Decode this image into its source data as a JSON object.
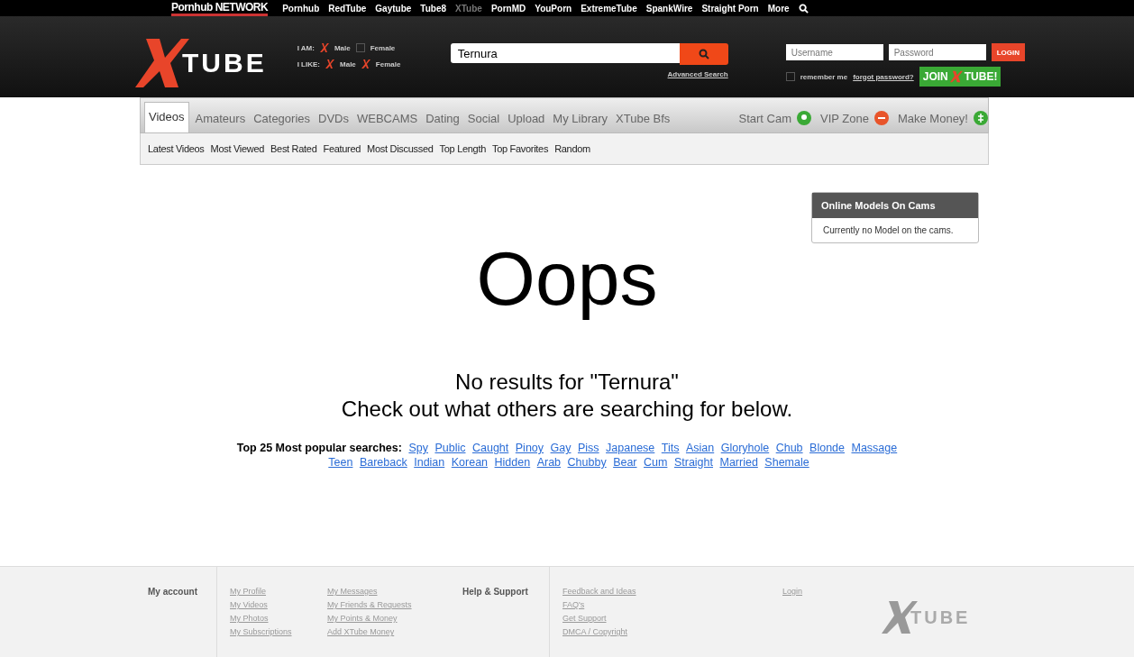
{
  "network": {
    "brand": "Pornhub NETWORK",
    "sites": [
      {
        "label": "Pornhub",
        "selected": false
      },
      {
        "label": "RedTube",
        "selected": false
      },
      {
        "label": "Gaytube",
        "selected": false
      },
      {
        "label": "Tube8",
        "selected": false
      },
      {
        "label": "XTube",
        "selected": true
      },
      {
        "label": "PornMD",
        "selected": false
      },
      {
        "label": "YouPorn",
        "selected": false
      },
      {
        "label": "ExtremeTube",
        "selected": false
      },
      {
        "label": "SpankWire",
        "selected": false
      },
      {
        "label": "Straight Porn",
        "selected": false
      },
      {
        "label": "More",
        "selected": false
      }
    ]
  },
  "header": {
    "logo": "TUBE",
    "preferences": [
      {
        "label": "I AM:",
        "options": [
          {
            "label": "Male",
            "checked": true
          },
          {
            "label": "Female",
            "checked": false
          }
        ]
      },
      {
        "label": "I LIKE:",
        "options": [
          {
            "label": "Male",
            "checked": true
          },
          {
            "label": "Female",
            "checked": true
          }
        ]
      }
    ],
    "search": {
      "value": "Ternura"
    },
    "advanced_search": "Advanced Search",
    "username": {
      "placeholder": "Username"
    },
    "password": {
      "placeholder": "Password"
    },
    "login_button": "LOGIN",
    "remember_me": {
      "label": "remember me",
      "checked": false
    },
    "forgot_password": "forgot password?",
    "join": {
      "left": "JOIN",
      "right": "TUBE!"
    }
  },
  "nav": {
    "tabs": [
      {
        "label": "Videos",
        "selected": true
      },
      {
        "label": "Amateurs",
        "selected": false
      },
      {
        "label": "Categories",
        "selected": false
      },
      {
        "label": "DVDs",
        "selected": false
      },
      {
        "label": "WEBCAMS",
        "selected": false
      },
      {
        "label": "Dating",
        "selected": false
      },
      {
        "label": "Social",
        "selected": false
      },
      {
        "label": "Upload",
        "selected": false
      },
      {
        "label": "My Library",
        "selected": false
      },
      {
        "label": "XTube Bfs",
        "selected": false
      }
    ],
    "extras": [
      {
        "label": "Start Cam",
        "kind": "cam",
        "color": "#3aa935"
      },
      {
        "label": "VIP Zone",
        "kind": "vip",
        "color": "#e8542a"
      },
      {
        "label": "Make Money!",
        "kind": "money",
        "color": "#3aa935"
      }
    ],
    "sub": [
      "Latest Videos",
      "Most Viewed",
      "Best Rated",
      "Featured",
      "Most Discussed",
      "Top Length",
      "Top Favorites",
      "Random"
    ]
  },
  "main": {
    "heading": "Oops",
    "message": "No results for \"Ternura\"",
    "hint": "Check out what others are searching for below.",
    "popular_label": "Top 25 Most popular searches:",
    "popular": [
      "Spy",
      "Public",
      "Caught",
      "Pinoy",
      "Gay",
      "Piss",
      "Japanese",
      "Tits",
      "Asian",
      "Gloryhole",
      "Chub",
      "Blonde",
      "Massage",
      "Teen",
      "Bareback",
      "Indian",
      "Korean",
      "Hidden",
      "Arab",
      "Chubby",
      "Bear",
      "Cum",
      "Straight",
      "Married",
      "Shemale"
    ]
  },
  "models_box": {
    "title": "Online Models On Cams",
    "text": "Currently no Model on the cams."
  },
  "footer": {
    "account_title": "My account",
    "account_col1": [
      "My Profile",
      "My Videos",
      "My Photos",
      "My Subscriptions"
    ],
    "account_col2": [
      "My Messages",
      "My Friends & Requests",
      "My Points & Money",
      "Add XTube Money"
    ],
    "help_title": "Help & Support",
    "help_links": [
      "Feedback and Ideas",
      "FAQ's",
      "Get Support",
      "DMCA / Copyright"
    ],
    "login": "Login",
    "logo": "TUBE"
  }
}
